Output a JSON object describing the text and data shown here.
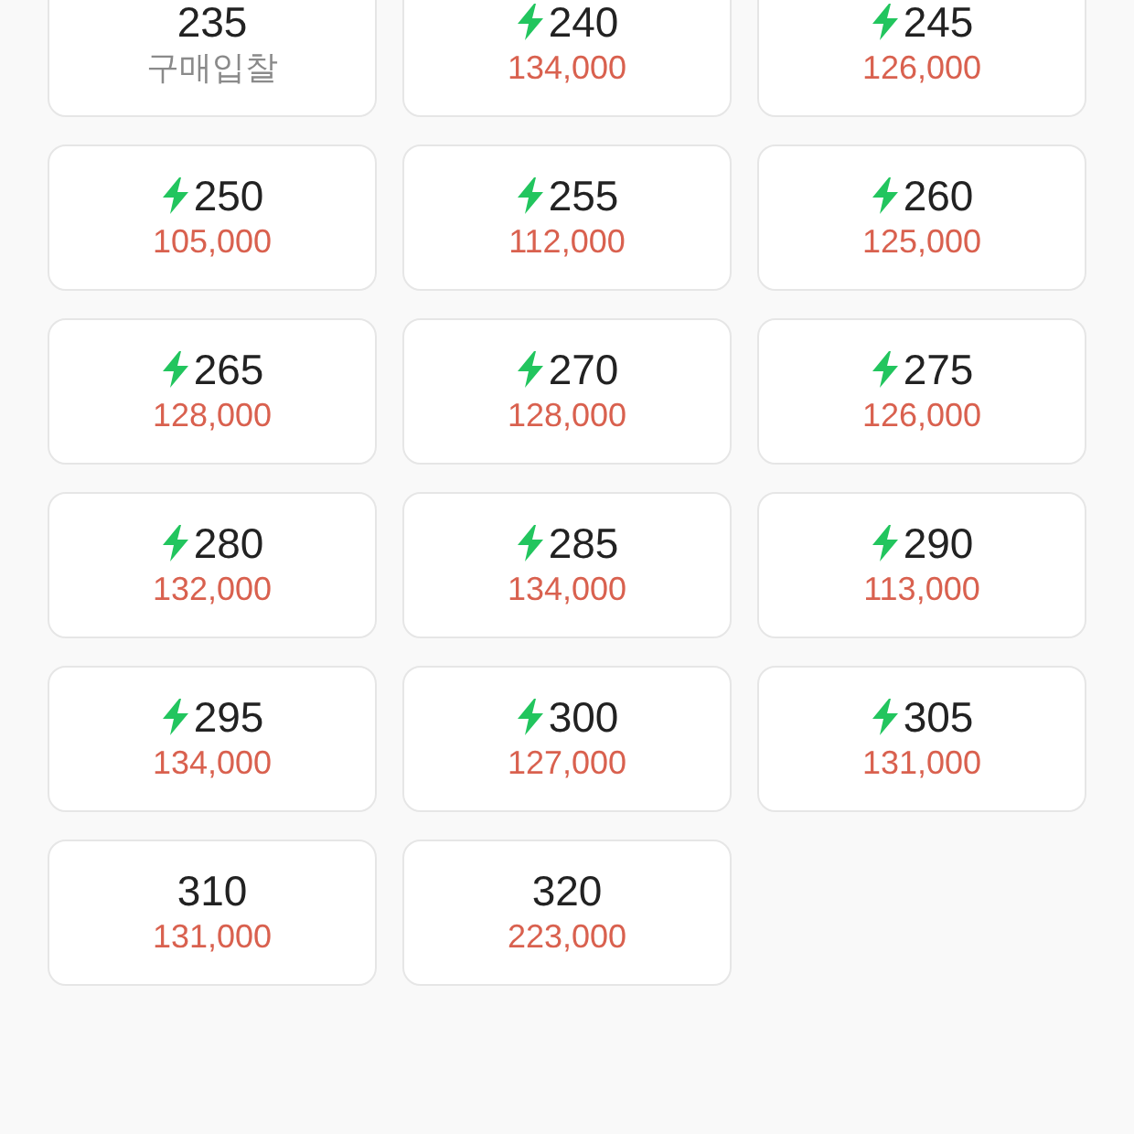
{
  "sizes": [
    {
      "size": "235",
      "express": false,
      "kind": "bid",
      "price": "구매입찰"
    },
    {
      "size": "240",
      "express": true,
      "kind": "price",
      "price": "134,000"
    },
    {
      "size": "245",
      "express": true,
      "kind": "price",
      "price": "126,000"
    },
    {
      "size": "250",
      "express": true,
      "kind": "price",
      "price": "105,000"
    },
    {
      "size": "255",
      "express": true,
      "kind": "price",
      "price": "112,000"
    },
    {
      "size": "260",
      "express": true,
      "kind": "price",
      "price": "125,000"
    },
    {
      "size": "265",
      "express": true,
      "kind": "price",
      "price": "128,000"
    },
    {
      "size": "270",
      "express": true,
      "kind": "price",
      "price": "128,000"
    },
    {
      "size": "275",
      "express": true,
      "kind": "price",
      "price": "126,000"
    },
    {
      "size": "280",
      "express": true,
      "kind": "price",
      "price": "132,000"
    },
    {
      "size": "285",
      "express": true,
      "kind": "price",
      "price": "134,000"
    },
    {
      "size": "290",
      "express": true,
      "kind": "price",
      "price": "113,000"
    },
    {
      "size": "295",
      "express": true,
      "kind": "price",
      "price": "134,000"
    },
    {
      "size": "300",
      "express": true,
      "kind": "price",
      "price": "127,000"
    },
    {
      "size": "305",
      "express": true,
      "kind": "price",
      "price": "131,000"
    },
    {
      "size": "310",
      "express": false,
      "kind": "price",
      "price": "131,000"
    },
    {
      "size": "320",
      "express": false,
      "kind": "price",
      "price": "223,000"
    }
  ]
}
